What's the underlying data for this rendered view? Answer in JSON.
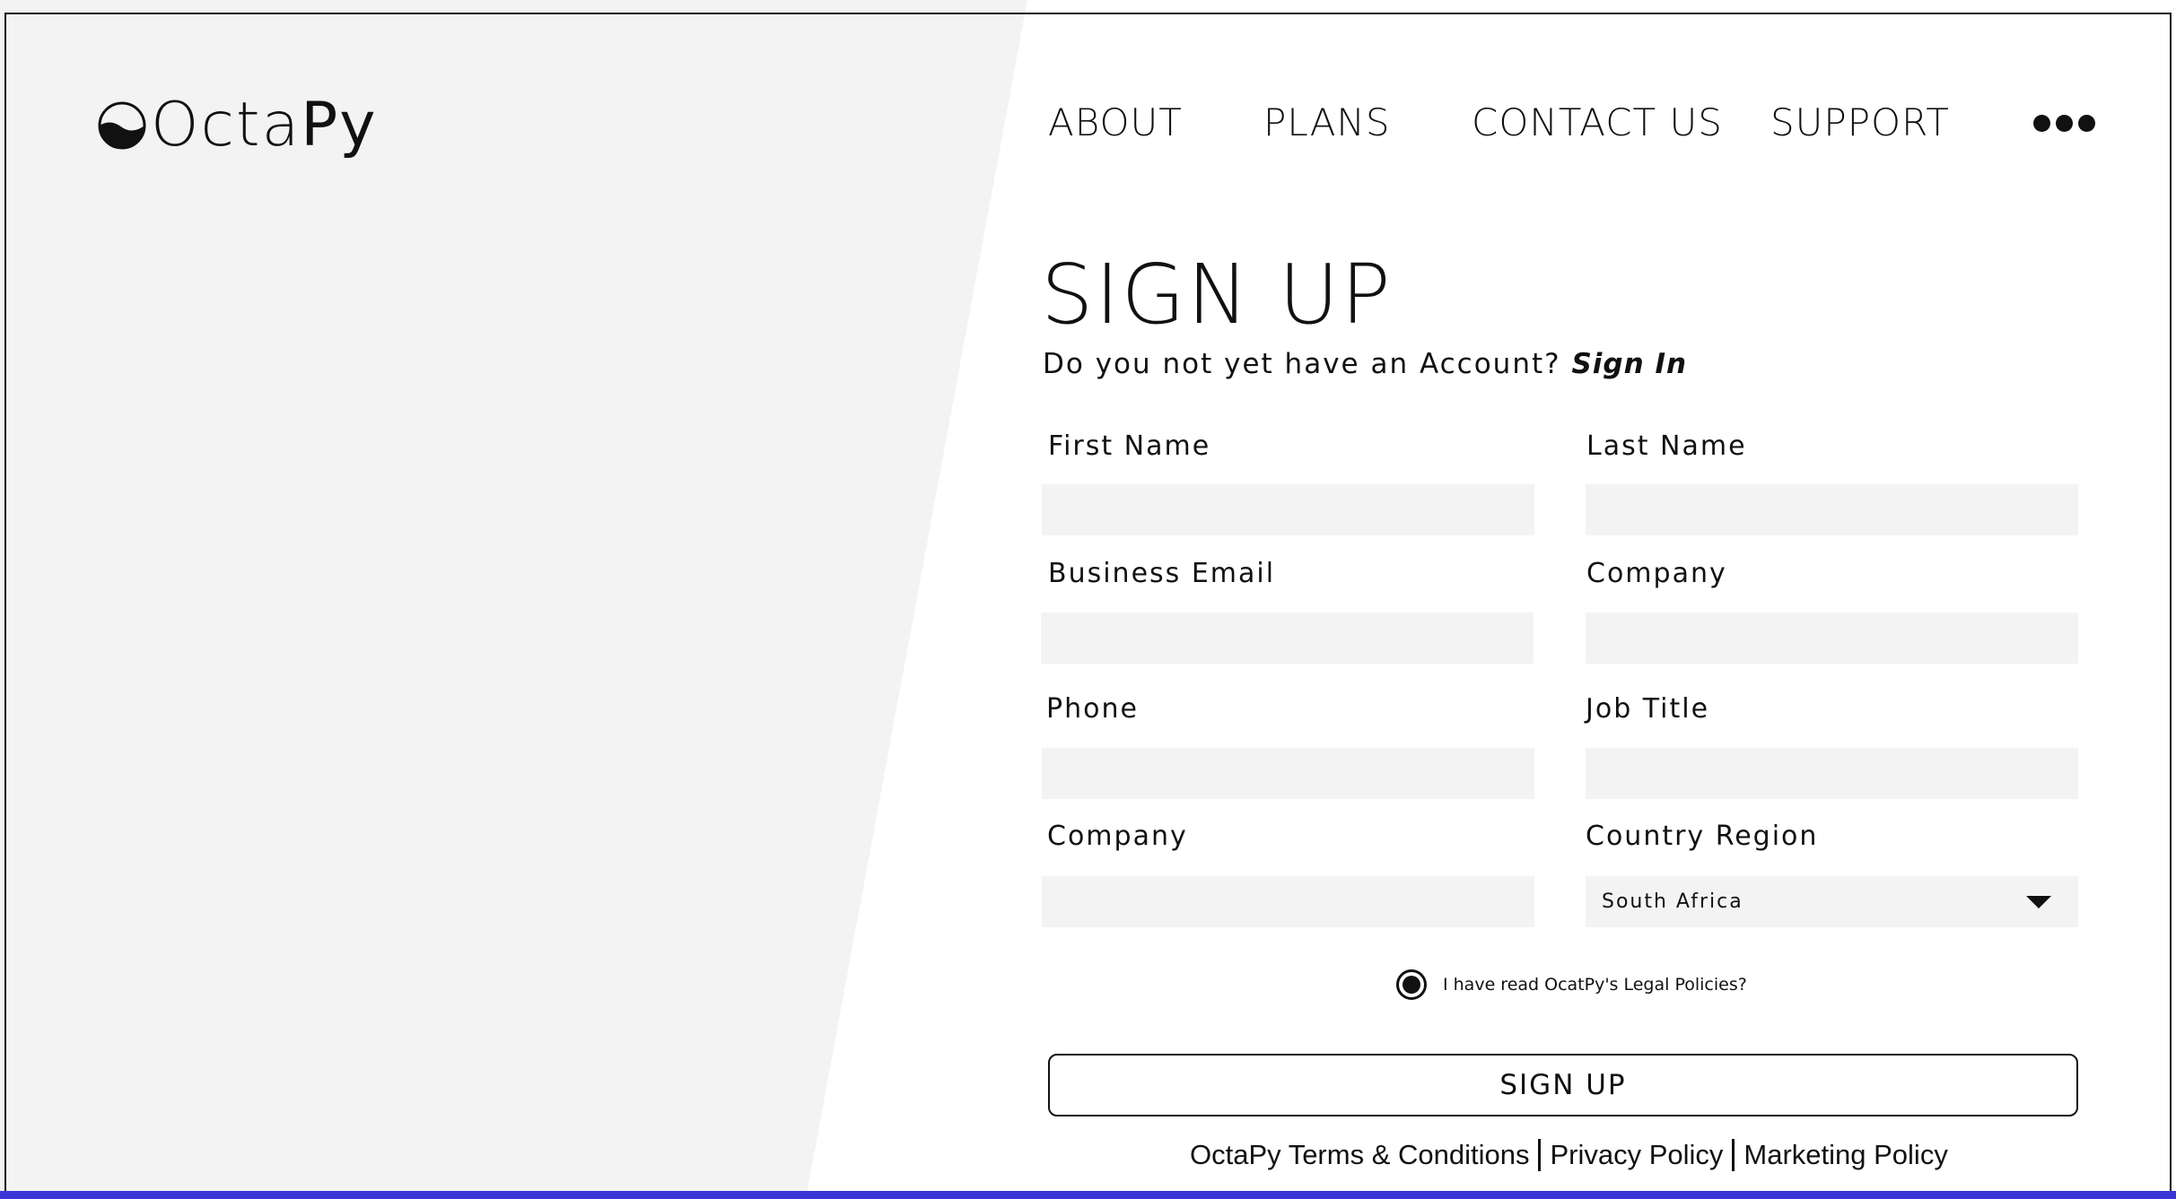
{
  "brand": {
    "name_light": "Octa",
    "name_strong": "Py"
  },
  "nav": {
    "items": [
      {
        "label": "ABOUT"
      },
      {
        "label": "PLANS"
      },
      {
        "label": "CONTACT US"
      },
      {
        "label": "SUPPORT"
      }
    ],
    "more_icon": "more-horizontal-icon"
  },
  "form": {
    "title": "SIGN UP",
    "subtitle": "Do you not yet have an Account?",
    "signin_link": "Sign In",
    "fields": [
      {
        "label": "First Name",
        "value": "",
        "placeholder": ""
      },
      {
        "label": "Last Name",
        "value": "",
        "placeholder": ""
      },
      {
        "label": "Business Email",
        "value": "",
        "placeholder": ""
      },
      {
        "label": "Company",
        "value": "",
        "placeholder": ""
      },
      {
        "label": "Phone",
        "value": "",
        "placeholder": ""
      },
      {
        "label": "Job Title",
        "value": "",
        "placeholder": ""
      },
      {
        "label": "Company",
        "value": "",
        "placeholder": ""
      },
      {
        "label": "Country Region",
        "value": "South Africa"
      }
    ],
    "consent_label": "I have read OcatPy's Legal Policies?",
    "consent_checked": true,
    "submit_label": "SIGN UP"
  },
  "footer": {
    "links": [
      {
        "label": "OctaPy Terms & Conditions"
      },
      {
        "label": "Privacy Policy"
      },
      {
        "label": "Marketing Policy"
      }
    ]
  },
  "colors": {
    "panel_gray": "#f3f3f3",
    "text": "#111111",
    "bottom_bar": "#3a34d6"
  }
}
